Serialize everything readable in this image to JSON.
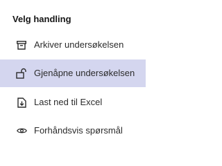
{
  "menu": {
    "title": "Velg handling",
    "highlight_color": "#d4d6ef",
    "items": [
      {
        "label": "Arkiver undersøkelsen",
        "icon": "archive-icon",
        "active": false
      },
      {
        "label": "Gjenåpne undersøkelsen",
        "icon": "unlock-icon",
        "active": true
      },
      {
        "label": "Last ned til Excel",
        "icon": "download-file-icon",
        "active": false
      },
      {
        "label": "Forhåndsvis spørsmål",
        "icon": "eye-icon",
        "active": false
      }
    ]
  }
}
